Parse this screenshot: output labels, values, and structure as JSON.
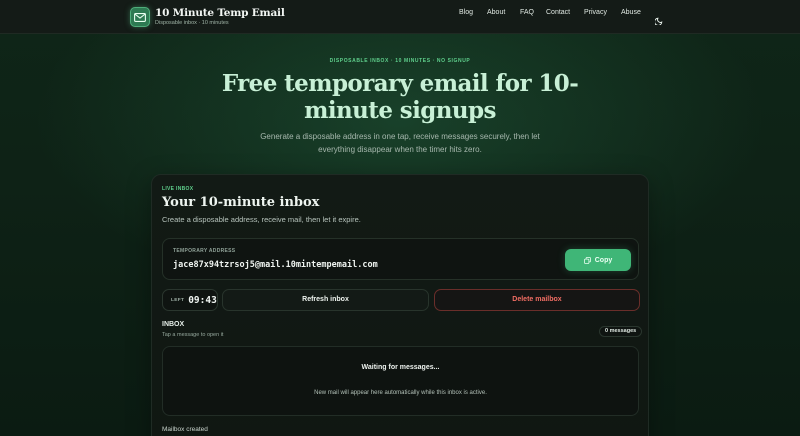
{
  "header": {
    "brand_title": "10 Minute Temp Email",
    "brand_subtitle": "Disposable inbox · 10 minutes",
    "nav": [
      "Blog",
      "About",
      "FAQ",
      "Contact",
      "Privacy",
      "Abuse"
    ],
    "theme_icon": "moon-icon"
  },
  "hero": {
    "eyebrow": "DISPOSABLE INBOX · 10 MINUTES · NO SIGNUP",
    "title": "Free temporary email for 10-minute signups",
    "subtitle": "Generate a disposable address in one tap, receive messages securely, then let everything disappear when the timer hits zero."
  },
  "card": {
    "live_label": "LIVE INBOX",
    "title": "Your 10-minute inbox",
    "subtitle": "Create a disposable address, receive mail, then let it expire.",
    "address_label": "TEMPORARY ADDRESS",
    "address": "jace87x94tzrsoj5@mail.10mintempemail.com",
    "copy_label": "Copy",
    "timer_left_label": "LEFT",
    "timer_value": "09:43",
    "refresh_label": "Refresh inbox",
    "delete_label": "Delete mailbox",
    "inbox_title": "INBOX",
    "inbox_hint": "Tap a message to open it",
    "message_count": "0 messages",
    "empty_title": "Waiting for messages...",
    "empty_subtitle": "New mail will appear here automatically while this inbox is active.",
    "status": "Mailbox created"
  },
  "colors": {
    "accent": "#3fb677",
    "danger": "#f06d63",
    "background": "#0c1a12"
  }
}
